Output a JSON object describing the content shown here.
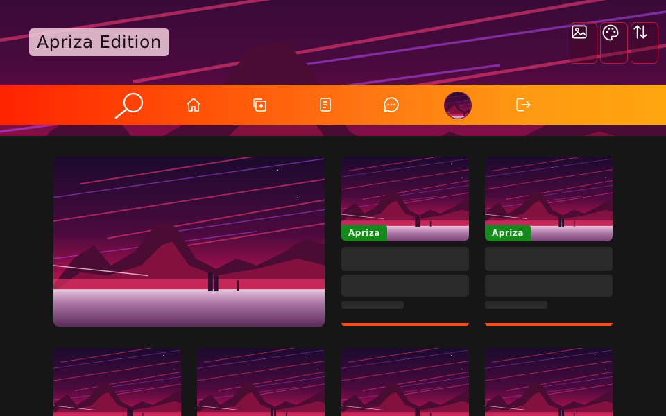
{
  "header": {
    "brand_label": "Apriza Edition",
    "actions": [
      {
        "name": "wallpaper-button",
        "icon": "image-icon"
      },
      {
        "name": "theme-button",
        "icon": "palette-icon"
      },
      {
        "name": "sort-button",
        "icon": "sort-arrows-icon"
      }
    ]
  },
  "nav": {
    "items": [
      {
        "name": "nav-search",
        "icon": "search-icon"
      },
      {
        "name": "nav-home",
        "icon": "home-icon"
      },
      {
        "name": "nav-new-post",
        "icon": "add-post-icon"
      },
      {
        "name": "nav-pages",
        "icon": "document-icon"
      },
      {
        "name": "nav-messages",
        "icon": "chat-icon"
      },
      {
        "name": "nav-profile",
        "icon": "avatar"
      },
      {
        "name": "nav-logout",
        "icon": "logout-icon"
      }
    ]
  },
  "cards": [
    {
      "label": "Apriza"
    },
    {
      "label": "Apriza"
    }
  ],
  "colors": {
    "nav_gradient_start": "#ff2200",
    "nav_gradient_end": "#ffa60f",
    "badge": "#138a1a",
    "accent": "#ff4a1a",
    "background": "#161616"
  }
}
